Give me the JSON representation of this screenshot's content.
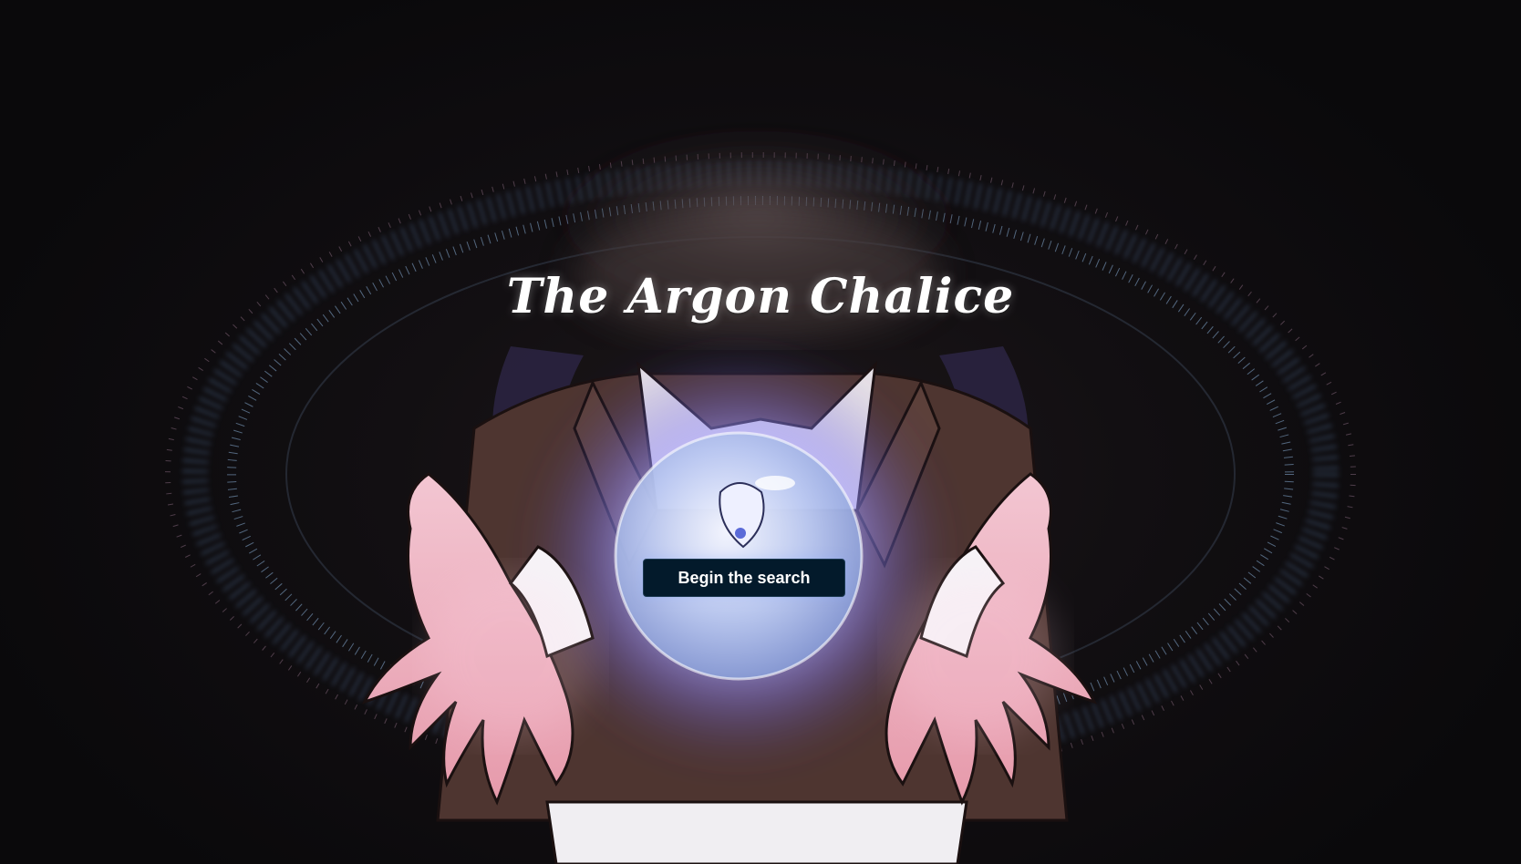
{
  "game": {
    "title": "The Argon Chalice",
    "start_button_label": "Begin the search"
  },
  "colors": {
    "background": "#0b0a0c",
    "button": "#031a2b",
    "orb_glow": "#c9c4ff",
    "sparkles": "#7fa8d8"
  }
}
